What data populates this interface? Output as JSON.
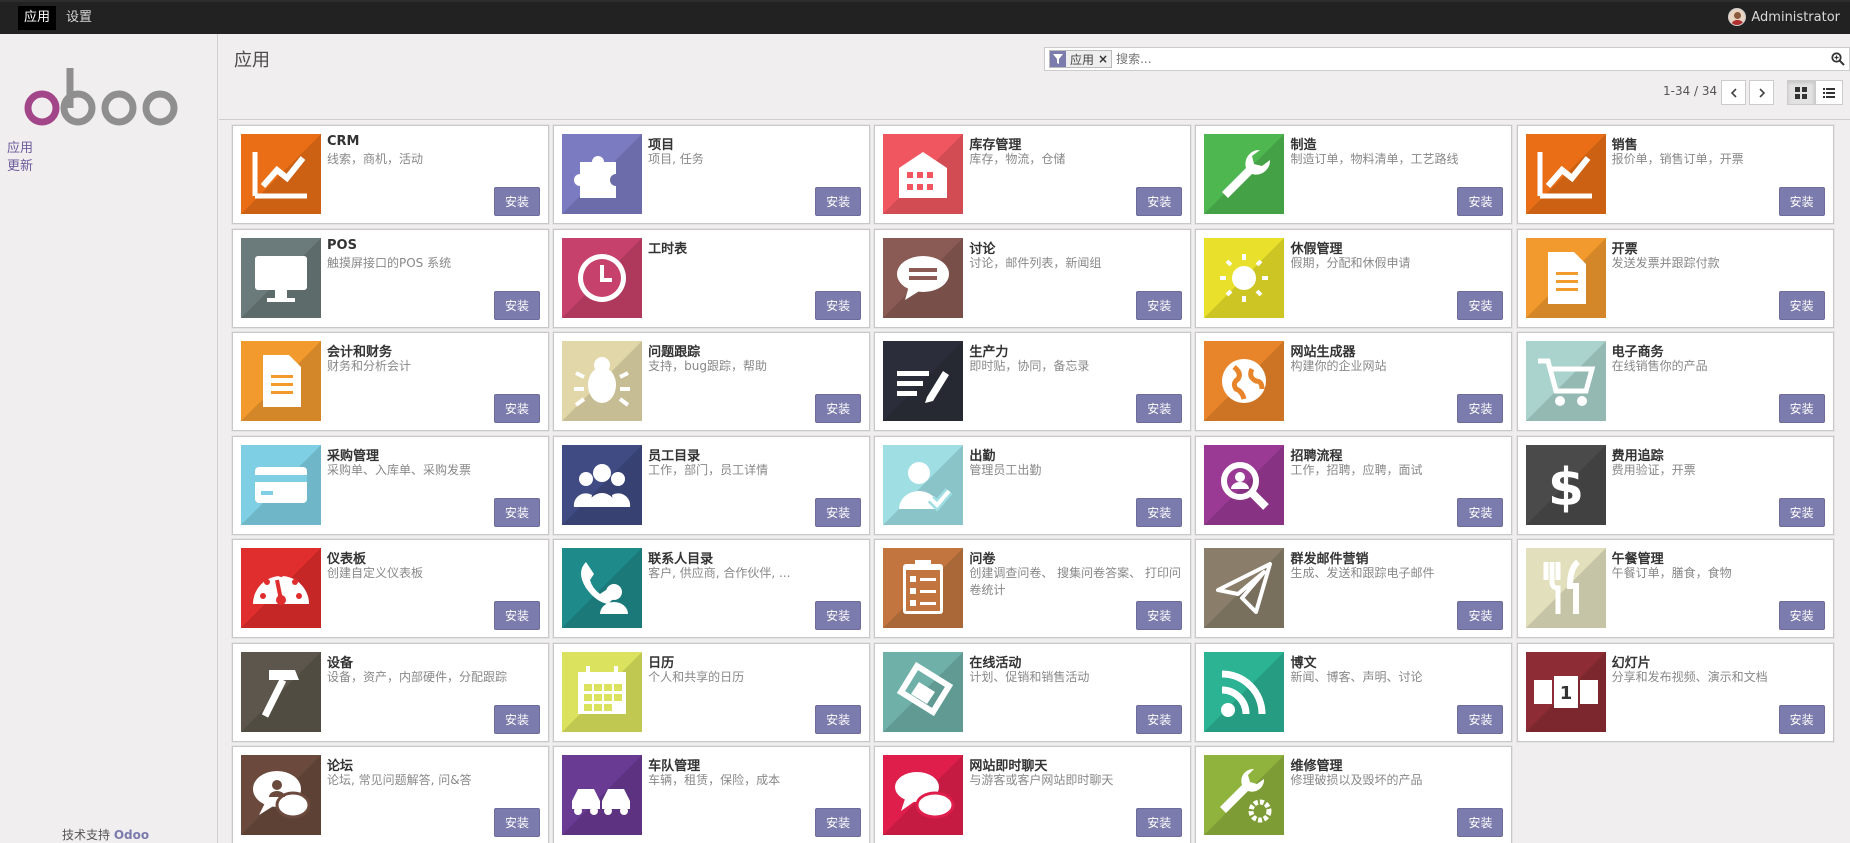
{
  "topbar": {
    "menu": [
      "应用",
      "设置"
    ],
    "user": "Administrator"
  },
  "sidebar": {
    "links": [
      "应用",
      "更新"
    ],
    "powered_prefix": "技术支持",
    "powered_brand": "Odoo"
  },
  "control": {
    "breadcrumb": "应用",
    "facet_label": "应用",
    "facet_close": "×",
    "search_placeholder": "搜索...",
    "pager": "1-34 / 34"
  },
  "apps": [
    {
      "name": "CRM",
      "summary": "线索，商机，活动",
      "icon": "chart-up-icon",
      "color": "#e96e16"
    },
    {
      "name": "项目",
      "summary": "项目, 任务",
      "icon": "puzzle-icon",
      "color": "#7a7bc0"
    },
    {
      "name": "库存管理",
      "summary": "库存，物流，仓储",
      "icon": "warehouse-icon",
      "color": "#f0565f"
    },
    {
      "name": "制造",
      "summary": "制造订单，物料清单，工艺路线",
      "icon": "wrench-icon",
      "color": "#4fb74f"
    },
    {
      "name": "销售",
      "summary": "报价单，销售订单，开票",
      "icon": "chart-up-icon",
      "color": "#e96e16"
    },
    {
      "name": "POS",
      "summary": "触摸屏接口的POS 系统",
      "icon": "monitor-icon",
      "color": "#6b7a7a"
    },
    {
      "name": "工时表",
      "summary": "",
      "icon": "clock-icon",
      "color": "#c6416b"
    },
    {
      "name": "讨论",
      "summary": "讨论，邮件列表，新闻组",
      "icon": "speech-bubble-icon",
      "color": "#8a5a55"
    },
    {
      "name": "休假管理",
      "summary": "假期，分配和休假申请",
      "icon": "sun-icon",
      "color": "#e8e02a"
    },
    {
      "name": "开票",
      "summary": "发送发票并跟踪付款",
      "icon": "document-icon",
      "color": "#f29a2e"
    },
    {
      "name": "会计和财务",
      "summary": "财务和分析会计",
      "icon": "document-icon",
      "color": "#f29a2e"
    },
    {
      "name": "问题跟踪",
      "summary": "支持，bug跟踪，帮助",
      "icon": "bug-icon",
      "color": "#e2d7a9"
    },
    {
      "name": "生产力",
      "summary": "即时贴，协同，备忘录",
      "icon": "notes-pencil-icon",
      "color": "#2b2e3a"
    },
    {
      "name": "网站生成器",
      "summary": "构建你的企业网站",
      "icon": "globe-icon",
      "color": "#e8852a"
    },
    {
      "name": "电子商务",
      "summary": "在线销售你的产品",
      "icon": "cart-icon",
      "color": "#a9d3cc"
    },
    {
      "name": "采购管理",
      "summary": "采购单、入库单、采购发票",
      "icon": "credit-card-icon",
      "color": "#7ecfe3"
    },
    {
      "name": "员工目录",
      "summary": "工作，部门，员工详情",
      "icon": "group-icon",
      "color": "#3f4b82"
    },
    {
      "name": "出勤",
      "summary": "管理员工出勤",
      "icon": "user-check-icon",
      "color": "#9fdfe3"
    },
    {
      "name": "招聘流程",
      "summary": "工作，招聘，应聘，面试",
      "icon": "magnifier-icon",
      "color": "#9a3a94"
    },
    {
      "name": "费用追踪",
      "summary": "费用验证，开票",
      "icon": "dollar-icon",
      "color": "#4a4a4a"
    },
    {
      "name": "仪表板",
      "summary": "创建自定义仪表板",
      "icon": "gauge-icon",
      "color": "#e02d2d"
    },
    {
      "name": "联系人目录",
      "summary": "客户, 供应商, 合作伙伴, ...",
      "icon": "contact-phone-icon",
      "color": "#1f8a8a"
    },
    {
      "name": "问卷",
      "summary": "创建调查问卷、 搜集问卷答案、 打印问卷统计",
      "icon": "clipboard-icon",
      "color": "#c2753f"
    },
    {
      "name": "群发邮件营销",
      "summary": "生成、发送和跟踪电子邮件",
      "icon": "paper-plane-icon",
      "color": "#8a7e6a"
    },
    {
      "name": "午餐管理",
      "summary": "午餐订单，膳食，食物",
      "icon": "fork-knife-icon",
      "color": "#e2dfbd"
    },
    {
      "name": "设备",
      "summary": "设备，资产，内部硬件，分配跟踪",
      "icon": "hammer-icon",
      "color": "#5c564c"
    },
    {
      "name": "日历",
      "summary": "个人和共享的日历",
      "icon": "calendar-icon",
      "color": "#dbe35e"
    },
    {
      "name": "在线活动",
      "summary": "计划、促销和销售活动",
      "icon": "ticket-icon",
      "color": "#6fb0a8"
    },
    {
      "name": "博文",
      "summary": "新闻、博客、声明、讨论",
      "icon": "rss-icon",
      "color": "#2bb394"
    },
    {
      "name": "幻灯片",
      "summary": "分享和发布视频、演示和文档",
      "icon": "slides-icon",
      "color": "#8e2c35"
    },
    {
      "name": "论坛",
      "summary": "论坛, 常见问题解答, 问&答",
      "icon": "chat-user-icon",
      "color": "#6b4a3d"
    },
    {
      "name": "车队管理",
      "summary": "车辆，租赁，保险，成本",
      "icon": "cars-icon",
      "color": "#6a3b93"
    },
    {
      "name": "网站即时聊天",
      "summary": "与游客或客户网站即时聊天",
      "icon": "chat-bubbles-icon",
      "color": "#e01e4b"
    },
    {
      "name": "维修管理",
      "summary": "修理破损以及毁坏的产品",
      "icon": "wrench-gear-icon",
      "color": "#8fb33d"
    }
  ],
  "install_label": "安装",
  "slides_badge": "1"
}
